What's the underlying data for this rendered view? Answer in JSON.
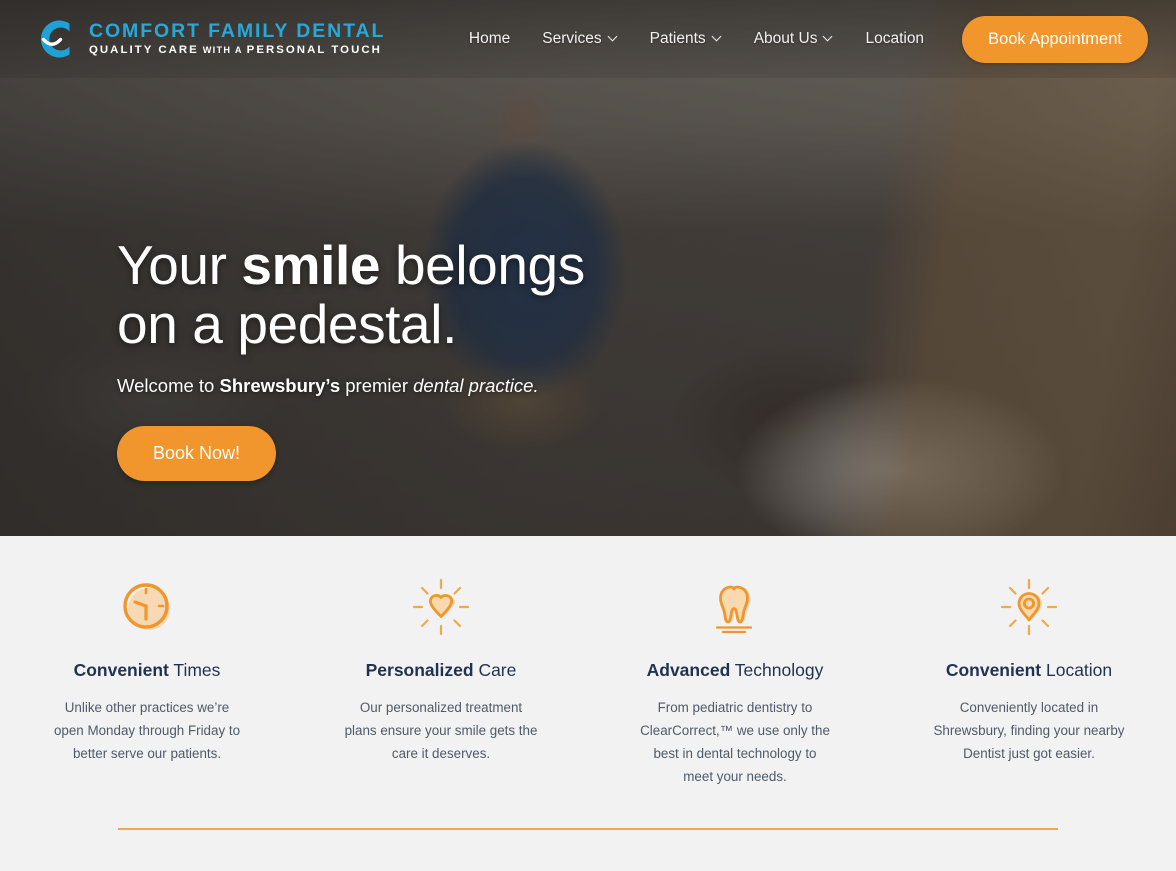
{
  "brand": {
    "name": "COMFORT FAMILY DENTAL",
    "tagline_1": "QUALITY CARE",
    "tagline_2": "WITH A",
    "tagline_3": "PERSONAL TOUCH",
    "logo_icon": "c-smile-logo-icon",
    "accent_color": "#29a8d8"
  },
  "nav": {
    "items": [
      {
        "label": "Home",
        "has_dropdown": false
      },
      {
        "label": "Services",
        "has_dropdown": true
      },
      {
        "label": "Patients",
        "has_dropdown": true
      },
      {
        "label": "About Us",
        "has_dropdown": true
      },
      {
        "label": "Location",
        "has_dropdown": false
      }
    ],
    "cta_label": "Book Appointment",
    "cta_color": "#f0962d"
  },
  "hero": {
    "title_part1": "Your ",
    "title_bold": "smile",
    "title_part2": " belongs",
    "title_line2": "on a pedestal.",
    "sub_part1": "Welcome to ",
    "sub_bold": "Shrewsbury’s",
    "sub_part2": " premier ",
    "sub_italic": "dental practice.",
    "cta_label": "Book Now!"
  },
  "features": [
    {
      "icon": "clock-icon",
      "title_bold": "Convenient",
      "title_rest": " Times",
      "body": "Unlike other practices we’re open Monday through Friday to better serve our patients."
    },
    {
      "icon": "radiant-heart-icon",
      "title_bold": "Personalized",
      "title_rest": " Care",
      "body": "Our personalized treatment plans ensure your smile gets the care it deserves."
    },
    {
      "icon": "tooth-icon",
      "title_bold": "Advanced",
      "title_rest": " Technology",
      "body": "From pediatric dentistry to ClearCorrect,™ we use only the best in dental technology to meet your needs."
    },
    {
      "icon": "radiant-map-pin-icon",
      "title_bold": "Convenient",
      "title_rest": " Location",
      "body": "Conveniently located in Shrewsbury, finding your nearby Dentist just got easier."
    }
  ],
  "colors": {
    "orange": "#f0962d",
    "orange_light": "#f4b672",
    "blue": "#29a8d8",
    "navy": "#1f3350",
    "section_bg": "#f2f2f2"
  }
}
